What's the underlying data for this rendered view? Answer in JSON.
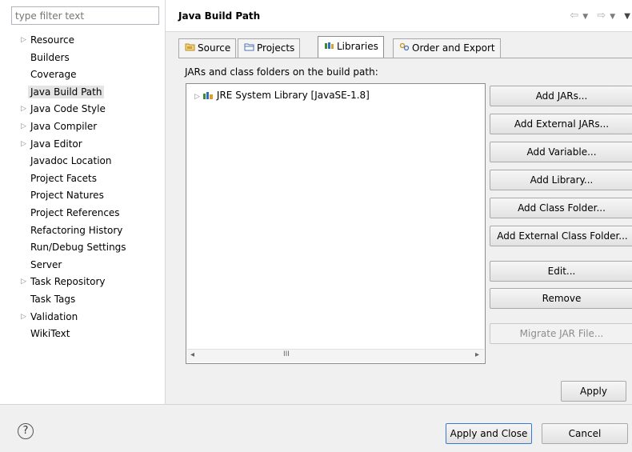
{
  "filter": {
    "placeholder": "type filter text"
  },
  "tree": [
    {
      "label": "Resource",
      "expandable": true
    },
    {
      "label": "Builders",
      "expandable": false
    },
    {
      "label": "Coverage",
      "expandable": false
    },
    {
      "label": "Java Build Path",
      "expandable": false,
      "selected": true
    },
    {
      "label": "Java Code Style",
      "expandable": true
    },
    {
      "label": "Java Compiler",
      "expandable": true
    },
    {
      "label": "Java Editor",
      "expandable": true
    },
    {
      "label": "Javadoc Location",
      "expandable": false
    },
    {
      "label": "Project Facets",
      "expandable": false
    },
    {
      "label": "Project Natures",
      "expandable": false
    },
    {
      "label": "Project References",
      "expandable": false
    },
    {
      "label": "Refactoring History",
      "expandable": false
    },
    {
      "label": "Run/Debug Settings",
      "expandable": false
    },
    {
      "label": "Server",
      "expandable": false
    },
    {
      "label": "Task Repository",
      "expandable": true
    },
    {
      "label": "Task Tags",
      "expandable": false
    },
    {
      "label": "Validation",
      "expandable": true
    },
    {
      "label": "WikiText",
      "expandable": false
    }
  ],
  "header": {
    "title": "Java Build Path"
  },
  "tabs": [
    {
      "label": "Source",
      "icon": "source-folder-icon"
    },
    {
      "label": "Projects",
      "icon": "project-folder-icon"
    },
    {
      "label": "Libraries",
      "icon": "library-icon",
      "active": true
    },
    {
      "label": "Order and Export",
      "icon": "order-export-icon"
    }
  ],
  "libraries": {
    "description": "JARs and class folders on the build path:",
    "entries": [
      {
        "label": "JRE System Library [JavaSE-1.8]",
        "icon": "library-icon"
      }
    ],
    "scroll_thumb": "III"
  },
  "buttons": {
    "add_jars": "Add JARs...",
    "add_external_jars": "Add External JARs...",
    "add_variable": "Add Variable...",
    "add_library": "Add Library...",
    "add_class_folder": "Add Class Folder...",
    "add_external_class_folder": "Add External Class Folder...",
    "edit": "Edit...",
    "remove": "Remove",
    "migrate_jar": "Migrate JAR File...",
    "apply": "Apply",
    "apply_and_close": "Apply and Close",
    "cancel": "Cancel"
  },
  "help": {
    "symbol": "?"
  },
  "colors": {
    "selection": "#e4e4e4",
    "library_icon": "#3a8c3a",
    "disabled_text": "#8d8d8d"
  }
}
